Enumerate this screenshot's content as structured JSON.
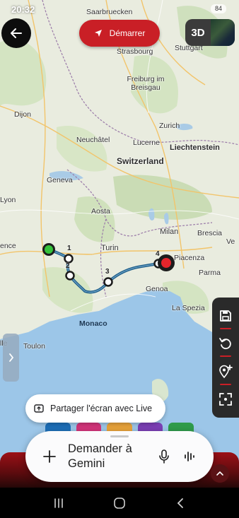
{
  "status_bar": {
    "time": "20:32",
    "battery": "84"
  },
  "header": {
    "start_label": "Démarrer",
    "mode_label": "3D"
  },
  "map": {
    "labels": {
      "saarbruecken": "Saarbruecken",
      "strasbourg": "Strasbourg",
      "stuttgart": "Stuttgart",
      "freiburg": "Freiburg im Breisgau",
      "dijon": "Dijon",
      "zurich": "Zurich",
      "liechtenstein": "Liechtenstein",
      "neuchatel": "Neuchâtel",
      "lucerne": "Lucerne",
      "switzerland": "Switzerland",
      "geneva": "Geneva",
      "lyon": "Lyon",
      "aosta": "Aosta",
      "milan": "Milan",
      "brescia": "Brescia",
      "turin": "Turin",
      "ence": "ence",
      "piacenza": "Piacenza",
      "parma": "Parma",
      "genoa": "Genoa",
      "monaco": "Monaco",
      "la_spezia": "La Spezia",
      "toulon": "Toulon",
      "lle": "lle",
      "ve": "Ve"
    },
    "waypoints": [
      "1",
      "2",
      "3",
      "4"
    ],
    "route_color": "#1f5f8b"
  },
  "overlay": {
    "share_label": "Partager l'écran avec Live",
    "gemini_prompt": "Demander à Gemini"
  },
  "icons": {
    "back": "arrow-left-icon",
    "navigate": "navigation-arrow-icon",
    "save": "save-icon",
    "undo": "undo-icon",
    "add_stop": "add-location-icon",
    "fit": "fit-screen-icon",
    "share": "share-screen-icon",
    "plus": "plus-icon",
    "mic": "microphone-icon",
    "live": "waveform-icon",
    "chevron": "chevron-up-icon"
  }
}
